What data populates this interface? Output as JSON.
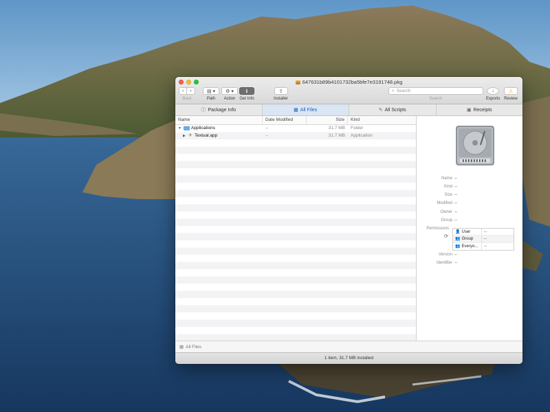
{
  "window": {
    "title": "647631b89b4101732ba5bfe7e3191748.pkg"
  },
  "toolbar": {
    "back_label": "Back",
    "path_label": "Path",
    "action_label": "Action",
    "getinfo_label": "Get Info",
    "installer_label": "Installer",
    "search_placeholder": "Search",
    "search_label": "Search",
    "exports_label": "Exports",
    "review_label": "Review"
  },
  "tabs": [
    {
      "label": "Package Info",
      "icon": "info-circle-icon"
    },
    {
      "label": "All Files",
      "icon": "files-icon",
      "active": true
    },
    {
      "label": "All Scripts",
      "icon": "script-icon"
    },
    {
      "label": "Receipts",
      "icon": "receipt-icon"
    }
  ],
  "file_list": {
    "columns": [
      "Name",
      "Date Modified",
      "Size",
      "Kind"
    ],
    "rows": [
      {
        "name": "Applications",
        "date": "--",
        "size": "31.7 MB",
        "kind": "Folder",
        "expanded": true
      },
      {
        "name": "Textual.app",
        "date": "--",
        "size": "31.7 MB",
        "kind": "Application",
        "expanded": false
      }
    ]
  },
  "inspector": {
    "fields": [
      {
        "label": "Name",
        "value": "--"
      },
      {
        "label": "Kind",
        "value": "--"
      },
      {
        "label": "Size",
        "value": "--"
      },
      {
        "label": "Modified",
        "value": "--"
      },
      {
        "label": "Owner",
        "value": "--"
      },
      {
        "label": "Group",
        "value": "--"
      }
    ],
    "permissions_label": "Permissions",
    "permissions": [
      {
        "who": "User",
        "priv": "--"
      },
      {
        "who": "Group",
        "priv": "--"
      },
      {
        "who": "Everyo...",
        "priv": "--"
      }
    ],
    "version_label": "Version",
    "version_value": "--",
    "identifier_label": "Identifier",
    "identifier_value": "--"
  },
  "path_bar": {
    "label": "All Files"
  },
  "status_bar": {
    "text": "1 item, 31.7 MB installed"
  },
  "colors": {
    "accent": "#1c5fbf",
    "active_tab_bg": "#dbe6f4",
    "folder": "#6aaee8"
  }
}
